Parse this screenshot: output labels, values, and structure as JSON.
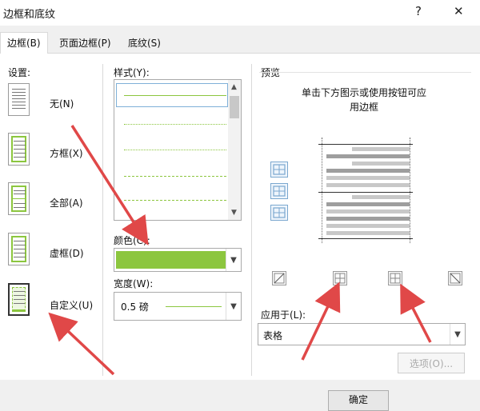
{
  "window": {
    "title": "边框和底纹",
    "help_label": "?",
    "close_label": "✕"
  },
  "tabs": [
    {
      "label": "边框(B)"
    },
    {
      "label": "页面边框(P)"
    },
    {
      "label": "底纹(S)"
    }
  ],
  "settings": {
    "heading": "设置:",
    "presets": [
      {
        "label": "无(N)"
      },
      {
        "label": "方框(X)"
      },
      {
        "label": "全部(A)"
      },
      {
        "label": "虚框(D)"
      },
      {
        "label": "自定义(U)"
      }
    ]
  },
  "style": {
    "label": "样式(Y):"
  },
  "color": {
    "label": "颜色(C):",
    "value_color": "#8cc63f"
  },
  "width": {
    "label": "宽度(W):",
    "value": "0.5 磅"
  },
  "preview": {
    "heading": "预览",
    "instruction_line1": "单击下方图示或使用按钮可应",
    "instruction_line2": "用边框"
  },
  "apply_to": {
    "label": "应用于(L):",
    "value": "表格"
  },
  "options_button": "选项(O)...",
  "ok_button": "确定",
  "colors": {
    "accent_green": "#8cc63f",
    "arrow_red": "#e04848",
    "selection_blue": "#7aa7cf"
  }
}
